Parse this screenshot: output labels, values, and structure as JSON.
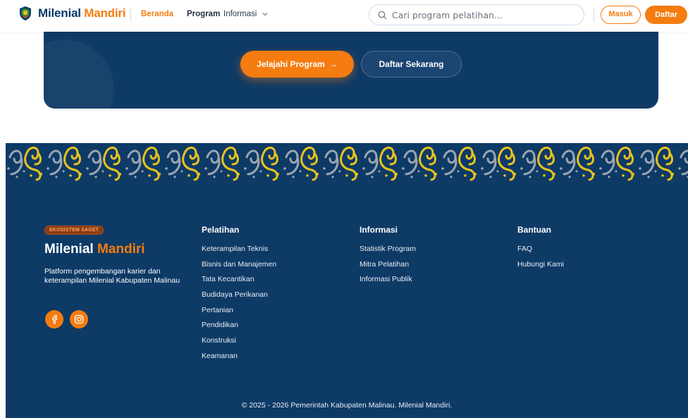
{
  "header": {
    "brand_part1": "Milenial",
    "brand_part2": "Mandiri",
    "nav": {
      "beranda": "Beranda",
      "program": "Program",
      "informasi": "Informasi"
    },
    "search": {
      "placeholder": "Cari program pelatihan..."
    },
    "login_label": "Masuk",
    "register_label": "Daftar"
  },
  "cta": {
    "explore_label": "Jelajahi Program",
    "explore_arrow": "→",
    "register_label": "Daftar Sekarang"
  },
  "footer": {
    "badge": "EKOSISTEM SAGET",
    "brand_part1": "Milenial",
    "brand_part2": "Mandiri",
    "description": "Platform pengembangan karier dan keterampilan Milenial Kabupaten Malinau",
    "socials": [
      "facebook-icon",
      "instagram-icon"
    ],
    "columns": [
      {
        "title": "Pelatihan",
        "links": [
          "Keterampilan Teknis",
          "Bisnis dan Manajemen",
          "Tata Kecantikan",
          "Budidaya Perikanan",
          "Pertanian",
          "Pendidikan",
          "Konstruksi",
          "Keamanan"
        ]
      },
      {
        "title": "Informasi",
        "links": [
          "Statistik Program",
          "Mitra Pelatihan",
          "Informasi Publik"
        ]
      },
      {
        "title": "Bantuan",
        "links": [
          "FAQ",
          "Hubungi Kami"
        ]
      }
    ],
    "copyright": "© 2025 - 2026 Pemerintah Kabupaten Malinau. Milenial Mandiri."
  },
  "colors": {
    "navy": "#0e3a66",
    "orange": "#f47c10",
    "batik_gold": "#e8c21d",
    "batik_gray": "#9aa5b1"
  }
}
